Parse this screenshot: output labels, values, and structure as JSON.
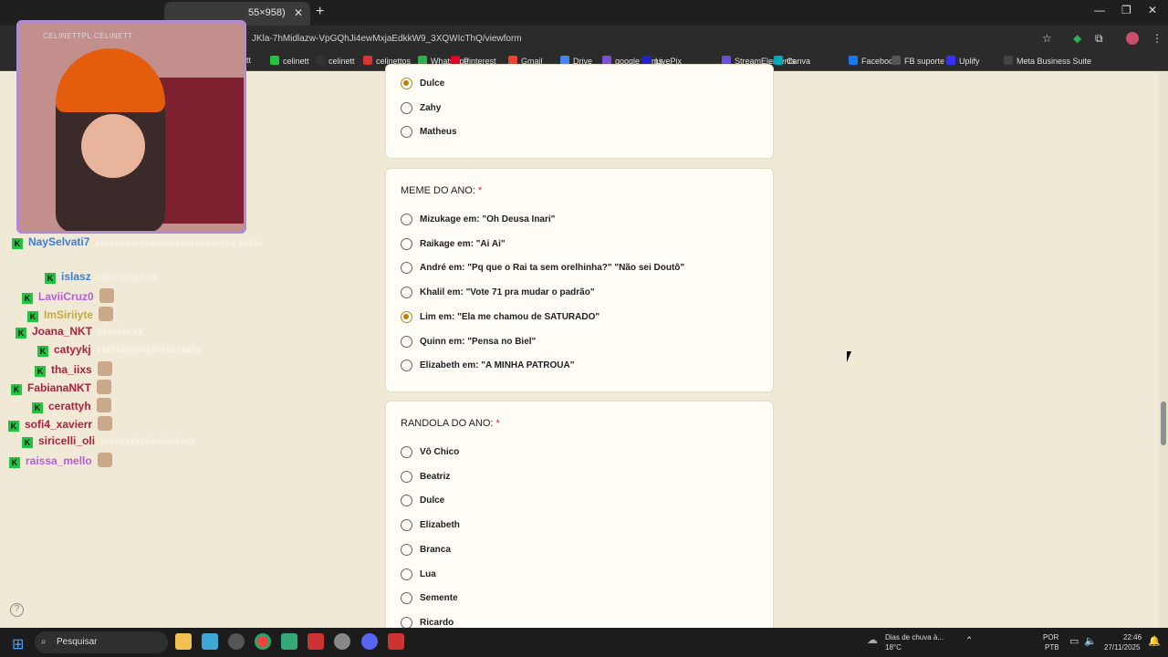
{
  "browser": {
    "tab_title": "55×958)",
    "url": "JKla-7hMidlazw-VpGQhJi4ewMxjaEdkkW9_3XQWIcThQ/viewform",
    "bookmarks": [
      "nett",
      "celinett",
      "celinett",
      "celinettos",
      "WhatsApp",
      "Pinterest",
      "Gmail",
      "Drive",
      "google forms",
      "LivePix",
      "StreamElements",
      "Canva",
      "Facebook",
      "FB suporte",
      "Uplify",
      "Meta Business Suite"
    ]
  },
  "overlay": {
    "social_handles": "CELINETTPL  CELINETT"
  },
  "chat": [
    {
      "user": "NaySelvati7",
      "color": "#3e7bd6",
      "msg": "kkkkkkkkkkkkkkkkkkkkkkkkkkkk kkkkk",
      "emote": false
    },
    {
      "user": "islasz",
      "color": "#3e7bd6",
      "msg": "toda uma lore",
      "emote": false
    },
    {
      "user": "LaviiCruz0",
      "color": "#b85cd9",
      "msg": "",
      "emote": true
    },
    {
      "user": "ImSiriiyte",
      "color": "#c9a93a",
      "msg": "",
      "emote": true
    },
    {
      "user": "Joana_NKT",
      "color": "#b0203a",
      "msg": "kkkkkkkkk",
      "emote": false
    },
    {
      "user": "catyykj",
      "color": "#b0203a",
      "msg": "kkkkkkkkkkkkkkkkkkkkk",
      "emote": false
    },
    {
      "user": "tha_iixs",
      "color": "#b0203a",
      "msg": "",
      "emote": true
    },
    {
      "user": "FabianaNKT",
      "color": "#b0203a",
      "msg": "",
      "emote": true
    },
    {
      "user": "cerattyh",
      "color": "#b0203a",
      "msg": "",
      "emote": true
    },
    {
      "user": "sofi4_xavierr",
      "color": "#b0203a",
      "msg": "",
      "emote": true
    },
    {
      "user": "siricelli_oli",
      "color": "#b0203a",
      "msg": "kkkkkkkkkkkkkkkkkkk",
      "emote": false
    },
    {
      "user": "raissa_mello",
      "color": "#b85cd9",
      "msg": "",
      "emote": true
    }
  ],
  "form": {
    "prev_question": {
      "options": [
        "Dulce",
        "Zahy",
        "Matheus"
      ],
      "selected": 0
    },
    "q_meme": {
      "title": "MEME DO ANO:",
      "required_mark": "*",
      "options": [
        "Mizukage em: \"Oh Deusa Inari\"",
        "Raikage em: \"Ai Ai\"",
        "André em: \"Pq que o Rai ta sem orelhinha?\" \"Não sei Doutô\"",
        "Khalil em: \"Vote 71 pra mudar o padrão\"",
        "Lim em: \"Ela me chamou de SATURADO\"",
        "Quinn em: \"Pensa no Biel\"",
        "Elizabeth em: \"A MINHA PATROUA\""
      ],
      "selected": 4
    },
    "q_randola": {
      "title": "RANDOLA DO ANO:",
      "required_mark": "*",
      "options": [
        "Vô Chico",
        "Beatriz",
        "Dulce",
        "Elizabeth",
        "Branca",
        "Lua",
        "Semente",
        "Ricardo"
      ],
      "selected": -1
    }
  },
  "taskbar": {
    "search_placeholder": "Pesquisar",
    "weather_text": "Dias de chuva à...",
    "temperature": "18°C",
    "language": "POR",
    "layout": "PTB",
    "time": "22:46",
    "date": "27/11/2025"
  }
}
